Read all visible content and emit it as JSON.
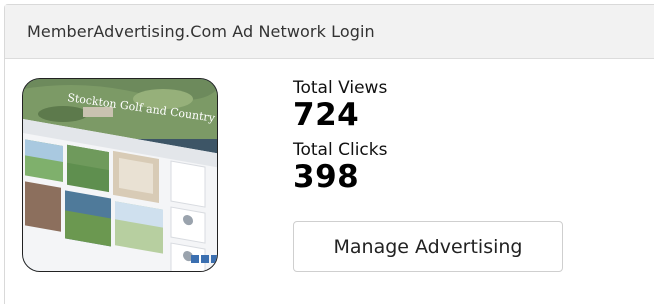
{
  "panel": {
    "title": "MemberAdvertising.Com Ad Network Login"
  },
  "thumbnail": {
    "banner_text": "Stockton Golf and Country Club"
  },
  "stats": {
    "views_label": "Total Views",
    "views_value": "724",
    "clicks_label": "Total Clicks",
    "clicks_value": "398"
  },
  "actions": {
    "manage_label": "Manage Advertising"
  }
}
